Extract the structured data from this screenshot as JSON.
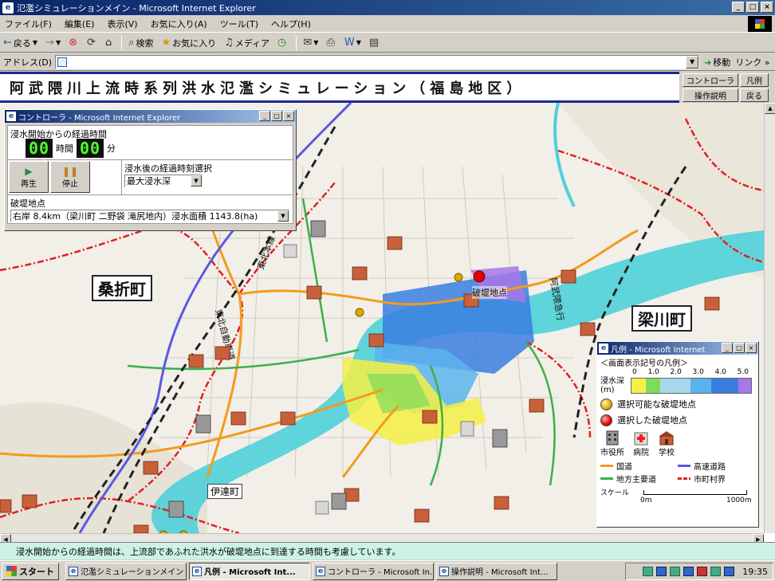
{
  "window": {
    "title": "氾濫シミュレーションメイン - Microsoft Internet Explorer"
  },
  "menu": [
    "ファイル(F)",
    "編集(E)",
    "表示(V)",
    "お気に入り(A)",
    "ツール(T)",
    "ヘルプ(H)"
  ],
  "toolbar": {
    "back": "戻る",
    "search": "検索",
    "favorites": "お気に入り",
    "media": "メディア"
  },
  "address": {
    "label": "アドレス(D)",
    "value": "",
    "go": "移動",
    "links": "リンク »"
  },
  "page": {
    "title": "阿武隈川上流時系列洪水氾濫シミュレーション（福島地区）",
    "nav": [
      "コントローラ",
      "凡例",
      "操作説明",
      "戻る"
    ]
  },
  "map": {
    "towns": [
      "桑折町",
      "梁川町",
      "伊達町"
    ],
    "breach_label": "破堤地点"
  },
  "controller": {
    "title": "コントローラ - Microsoft Internet Explorer",
    "elapsed_caption": "浸水開始からの経過時間",
    "hours": "00",
    "hours_unit": "時間",
    "minutes": "00",
    "minutes_unit": "分",
    "play": "再生",
    "stop": "停止",
    "time_select_caption": "浸水後の経過時刻選択",
    "time_select_value": "最大浸水深",
    "breach_caption": "破堤地点",
    "breach_value": "右岸 8.4km（梁川町 二野袋 滝尻地内）浸水面積 1143.8(ha)"
  },
  "legend": {
    "title": "凡例 - Microsoft Internet",
    "heading": "＜画面表示記号の凡例＞",
    "depth_label": "浸水深",
    "depth_unit": "(m)",
    "depth_ticks": [
      "0",
      "1.0",
      "2.0",
      "3.0",
      "4.0",
      "5.0"
    ],
    "depth_colors": [
      "#f5f044",
      "#7fdc5a",
      "#a8d8f0",
      "#5ab4ec",
      "#3a7ee0",
      "#a678e8"
    ],
    "selectable": "選択可能な破堤地点",
    "selected": "選択した破堤地点",
    "buildings": [
      "市役所",
      "病院",
      "学校"
    ],
    "lines": [
      {
        "label": "国道",
        "color": "#f39a1e"
      },
      {
        "label": "高速道路",
        "color": "#5a5ae0"
      },
      {
        "label": "地方主要道",
        "color": "#3ab04a"
      },
      {
        "label": "市町村界",
        "color": "#e02020"
      }
    ],
    "scale_label": "スケール",
    "scale_min": "0m",
    "scale_max": "1000m"
  },
  "status": "浸水開始からの経過時間は、上流部であふれた洪水が破堤地点に到達する時間も考慮しています。",
  "taskbar": {
    "start": "スタート",
    "items": [
      "氾濫シミュレーションメイン -...",
      "凡例 - Microsoft Int...",
      "コントローラ - Microsoft In...",
      "操作説明 - Microsoft Int..."
    ],
    "clock": "19:35"
  }
}
